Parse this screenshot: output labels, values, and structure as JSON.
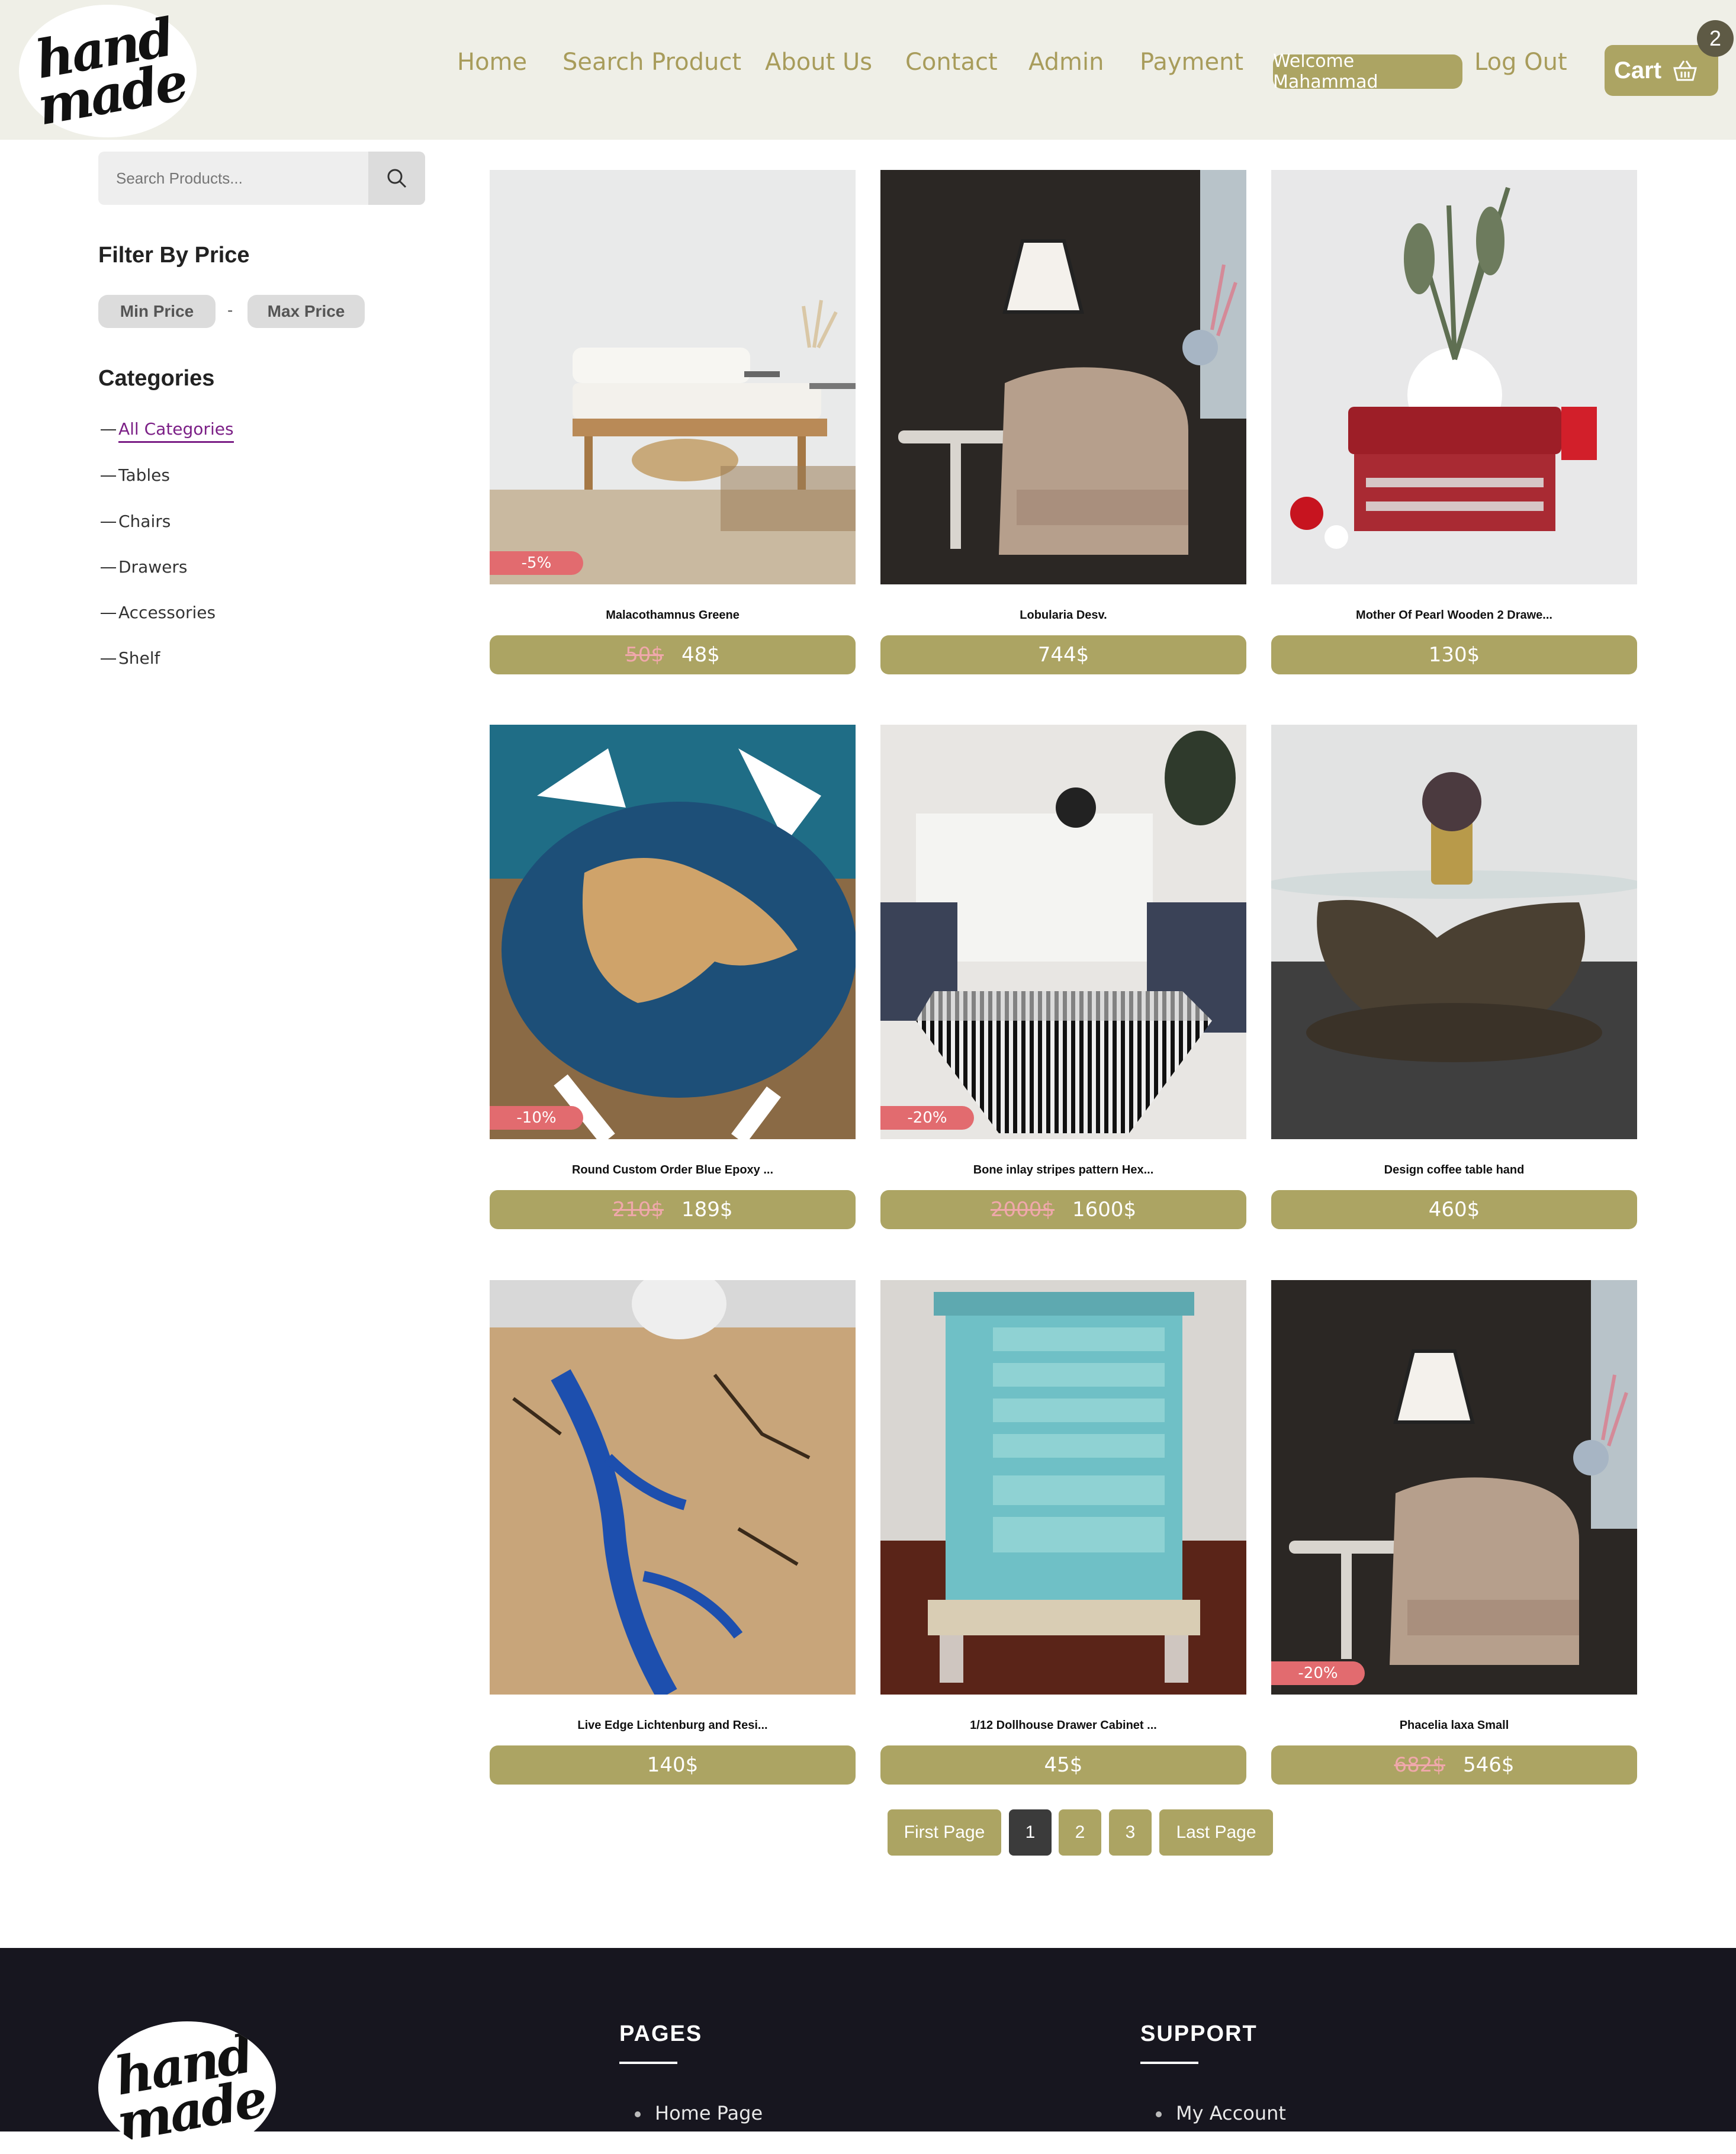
{
  "brand": {
    "logo_line1": "hand",
    "logo_line2": "made"
  },
  "nav": {
    "items": [
      "Home",
      "Search Product",
      "About Us",
      "Contact",
      "Admin",
      "Payment"
    ],
    "welcome": "Welcome Mahammad",
    "logout": "Log Out",
    "cart_label": "Cart",
    "cart_count": "2"
  },
  "sidebar": {
    "search_placeholder": "Search Products...",
    "filter_title": "Filter By Price",
    "min_price": "Min Price",
    "separator": "-",
    "max_price": "Max Price",
    "categories_title": "Categories",
    "categories": [
      "All Categories",
      "Tables",
      "Chairs",
      "Drawers",
      "Accessories",
      "Shelf"
    ]
  },
  "products": [
    {
      "name": "Malacothamnus Greene",
      "old_price": "50$",
      "price": "48$",
      "discount": "-5%"
    },
    {
      "name": "Lobularia Desv.",
      "old_price": "",
      "price": "744$",
      "discount": ""
    },
    {
      "name": "Mother Of Pearl Wooden 2 Drawe...",
      "old_price": "",
      "price": "130$",
      "discount": ""
    },
    {
      "name": "Round Custom Order Blue Epoxy ...",
      "old_price": "210$",
      "price": "189$",
      "discount": "-10%"
    },
    {
      "name": "Bone inlay stripes pattern Hex...",
      "old_price": "2000$",
      "price": "1600$",
      "discount": "-20%"
    },
    {
      "name": "Design coffee table hand",
      "old_price": "",
      "price": "460$",
      "discount": ""
    },
    {
      "name": "Live Edge Lichtenburg and Resi...",
      "old_price": "",
      "price": "140$",
      "discount": ""
    },
    {
      "name": "1/12 Dollhouse Drawer Cabinet ...",
      "old_price": "",
      "price": "45$",
      "discount": ""
    },
    {
      "name": "Phacelia laxa Small",
      "old_price": "682$",
      "price": "546$",
      "discount": "-20%"
    }
  ],
  "pagination": {
    "first": "First Page",
    "pages": [
      "1",
      "2",
      "3"
    ],
    "current": "1",
    "last": "Last Page"
  },
  "footer": {
    "pages_title": "PAGES",
    "pages_links": [
      "Home Page"
    ],
    "support_title": "SUPPORT",
    "support_links": [
      "My Account"
    ]
  },
  "colors": {
    "accent": "#aca463",
    "header_bg": "#efefe7",
    "discount": "#e26b6f",
    "footer_bg": "#17161f",
    "active_category": "#7b1f86"
  }
}
